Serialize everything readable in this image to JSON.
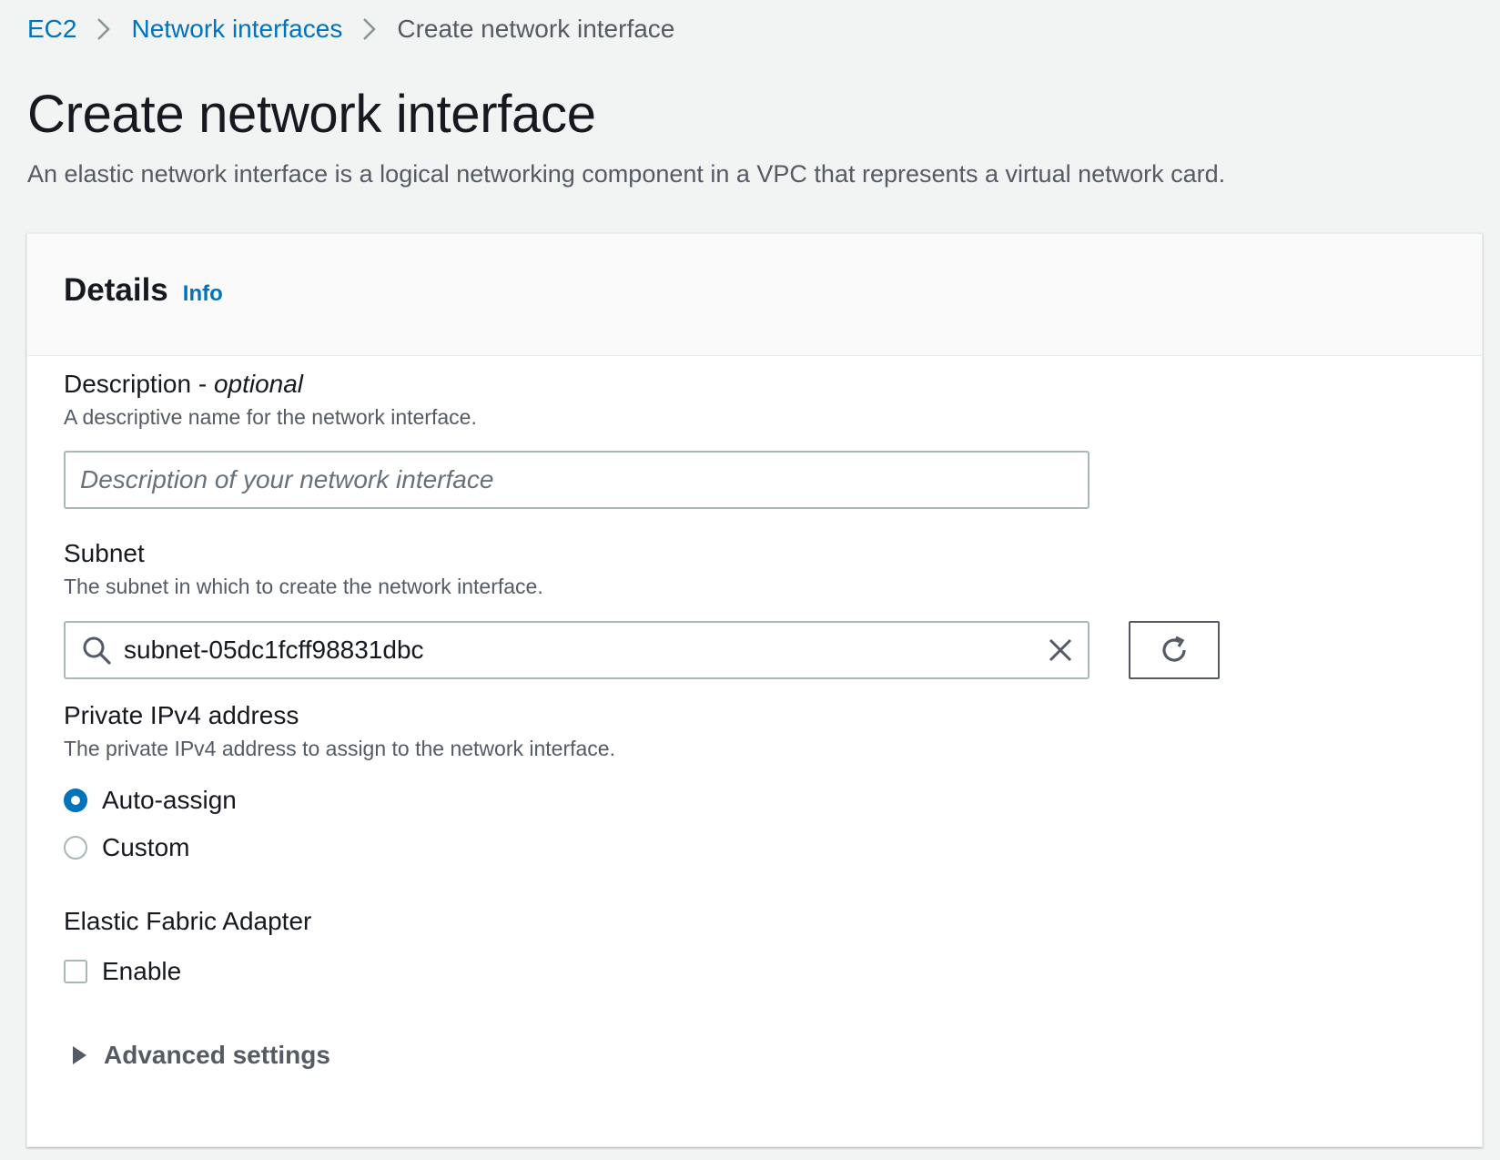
{
  "breadcrumb": {
    "items": [
      {
        "label": "EC2"
      },
      {
        "label": "Network interfaces"
      },
      {
        "label": "Create network interface"
      }
    ]
  },
  "header": {
    "title": "Create network interface",
    "description": "An elastic network interface is a logical networking component in a VPC that represents a virtual network card."
  },
  "details": {
    "title": "Details",
    "info_link": "Info",
    "description_field": {
      "label": "Description - ",
      "label_optional": "optional",
      "hint": "A descriptive name for the network interface.",
      "value": "",
      "placeholder": "Description of your network interface"
    },
    "subnet_field": {
      "label": "Subnet",
      "hint": "The subnet in which to create the network interface.",
      "value": "subnet-05dc1fcff98831dbc"
    },
    "ipv4_field": {
      "label": "Private IPv4 address",
      "hint": "The private IPv4 address to assign to the network interface.",
      "options": [
        {
          "label": "Auto-assign",
          "selected": true
        },
        {
          "label": "Custom",
          "selected": false
        }
      ]
    },
    "efa_field": {
      "label": "Elastic Fabric Adapter",
      "checkbox_label": "Enable",
      "checked": false
    },
    "advanced_settings": {
      "label": "Advanced settings",
      "expanded": false
    }
  },
  "colors": {
    "link": "#0073bb",
    "text_primary": "#16191f",
    "text_secondary": "#545b64",
    "border": "#aab7b8",
    "background": "#f2f3f3",
    "panel": "#ffffff"
  }
}
